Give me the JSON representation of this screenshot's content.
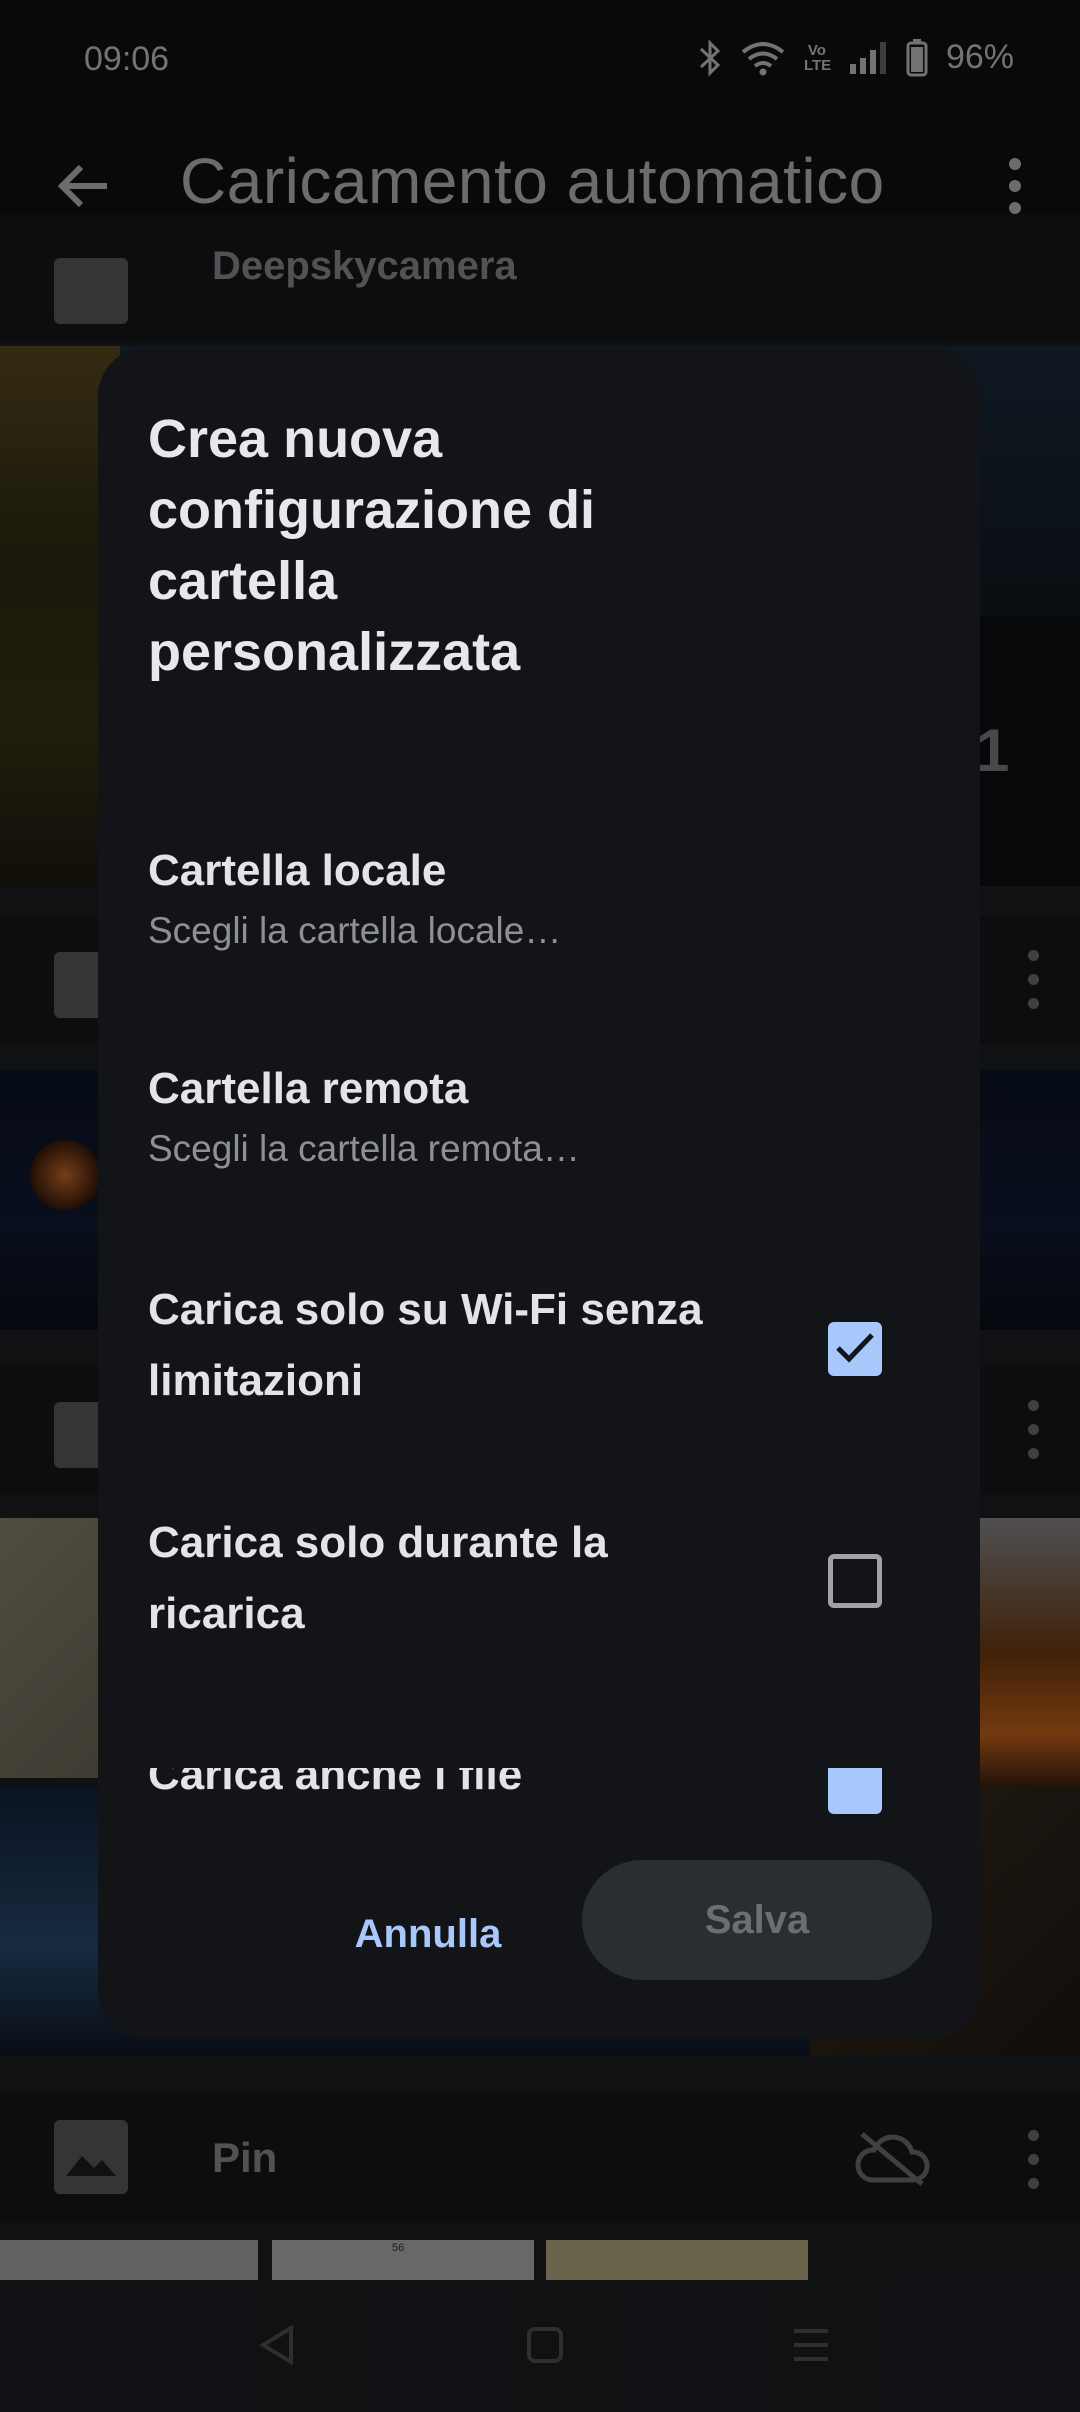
{
  "status_bar": {
    "time": "09:06",
    "network": "Vo LTE",
    "battery": "96%"
  },
  "app_bar": {
    "title": "Caricamento automatico",
    "back_icon": "arrow-back-icon",
    "more_icon": "more-vert-icon"
  },
  "background": {
    "top_row_label": "Deepskycamera",
    "pin_row_label": "Pin",
    "thumb_text": "56"
  },
  "dialog": {
    "title": "Crea nuova configurazione di cartella personalizzata",
    "local_folder": {
      "title": "Cartella locale",
      "summary": "Scegli la cartella locale…"
    },
    "remote_folder": {
      "title": "Cartella remota",
      "summary": "Scegli la cartella remota…"
    },
    "wifi_only": {
      "title": "Carica solo su Wi-Fi senza limitazioni",
      "checked": true
    },
    "charging_only": {
      "title": "Carica solo durante la ricarica",
      "checked": false
    },
    "existing_files": {
      "title": "Carica anche i file",
      "checked": true
    },
    "cancel_label": "Annulla",
    "save_label": "Salva"
  },
  "colors": {
    "accent": "#a8c7fa",
    "dialog_bg": "#121418",
    "disabled_text": "#6c6e72"
  }
}
